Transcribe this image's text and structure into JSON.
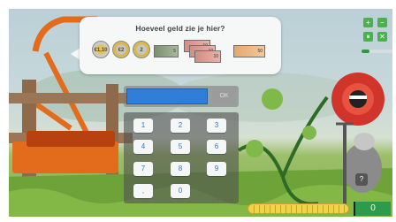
{
  "prompt": {
    "question": "Hoeveel geld zie je hier?"
  },
  "money": {
    "coins": [
      {
        "label": "€1,10",
        "kind": "bimetal-gold"
      },
      {
        "label": "€2",
        "kind": "bimetal-silver"
      },
      {
        "label": "2",
        "kind": "bimetal-silver"
      }
    ],
    "notes": [
      {
        "label": "5",
        "kind": "green"
      },
      {
        "label": "10",
        "kind": "n10"
      },
      {
        "label": "10",
        "kind": "n10"
      },
      {
        "label": "10",
        "kind": "n10"
      },
      {
        "label": "50",
        "kind": "n50"
      }
    ]
  },
  "answer": {
    "ok_label": "OK"
  },
  "keypad": {
    "keys": [
      "1",
      "2",
      "3",
      "4",
      "5",
      "6",
      "7",
      "8",
      "9",
      ",",
      "0"
    ]
  },
  "controls": {
    "zoom_in": "+",
    "zoom_out": "−",
    "pause": "⏸",
    "close": "✕",
    "help": "?"
  },
  "progress": {
    "round_fraction": 0.25
  },
  "score": {
    "value": "0"
  },
  "colors": {
    "accent_green": "#4caf50",
    "answer_blue": "#2f7fd8",
    "coin_gold": "#f1d34b"
  }
}
